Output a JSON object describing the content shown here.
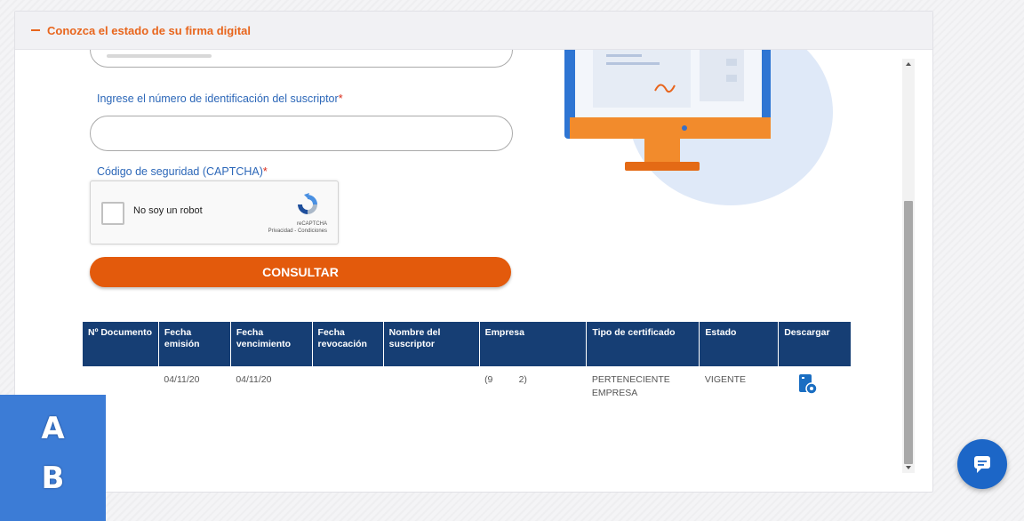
{
  "panel": {
    "header_title": "Conozca el estado de su firma digital",
    "id_label": "Ingrese el número de identificación del suscriptor",
    "captcha_label": "Código de seguridad (CAPTCHA)",
    "required_mark": "*",
    "captcha": {
      "checkbox_label": "No soy un robot",
      "brand": "reCAPTCHA",
      "links": "Privacidad - Condiciones"
    },
    "submit_label": "CONSULTAR"
  },
  "table": {
    "headers": [
      "Nº Documento",
      "Fecha emisión",
      "Fecha vencimiento",
      "Fecha revocación",
      "Nombre del suscriptor",
      "Empresa",
      "Tipo de certificado",
      "Estado",
      "Descargar"
    ],
    "rows": [
      {
        "documento": "",
        "emision": "04/11/20",
        "vencimiento": "04/11/20",
        "revocacion": "",
        "nombre": "",
        "empresa": "(9          2)",
        "tipo": "PERTENECIENTE EMPRESA",
        "estado": "VIGENTE"
      }
    ]
  },
  "overlay": {
    "letter_a": "A",
    "letter_b": "B"
  },
  "colors": {
    "accent": "#e8651c",
    "button": "#e35a0c",
    "header_bg": "#163e74",
    "label": "#2c67b8",
    "chat": "#1c66c7"
  },
  "icons": {
    "chat": "chat-bubble-icon",
    "download": "download-document-icon",
    "collapse": "minus-icon"
  }
}
